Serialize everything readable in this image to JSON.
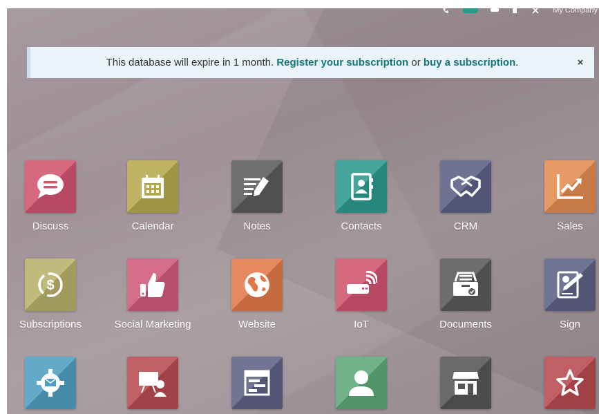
{
  "systray": {
    "company": "My Company"
  },
  "banner": {
    "text_before": "This database will expire in 1 month. ",
    "register_link": "Register your subscription",
    "text_middle": " or ",
    "buy_link": "buy a subscription",
    "text_after": ".",
    "close": "×"
  },
  "apps": [
    {
      "label": "Discuss",
      "icon": "chat-bubble-icon",
      "color": "#d0546f"
    },
    {
      "label": "Calendar",
      "icon": "calendar-icon",
      "color": "#b6a84e"
    },
    {
      "label": "Notes",
      "icon": "notes-icon",
      "color": "#5b5b5b"
    },
    {
      "label": "Contacts",
      "icon": "address-book-icon",
      "color": "#2e9a8e"
    },
    {
      "label": "CRM",
      "icon": "handshake-icon",
      "color": "#5c5f85"
    },
    {
      "label": "Sales",
      "icon": "trend-chart-icon",
      "color": "#e28b4f"
    },
    {
      "label": "Subscriptions",
      "icon": "dollar-cycle-icon",
      "color": "#b8b06a"
    },
    {
      "label": "Social Marketing",
      "icon": "thumbs-up-icon",
      "color": "#cf5a7b"
    },
    {
      "label": "Website",
      "icon": "globe-icon",
      "color": "#e0794a"
    },
    {
      "label": "IoT",
      "icon": "iot-device-icon",
      "color": "#d0546f"
    },
    {
      "label": "Documents",
      "icon": "file-drawer-icon",
      "color": "#595959"
    },
    {
      "label": "Sign",
      "icon": "sign-document-icon",
      "color": "#5f6184"
    },
    {
      "label": "",
      "icon": "gear-mail-icon",
      "color": "#4f9ec1"
    },
    {
      "label": "",
      "icon": "presentation-icon",
      "color": "#b84a4f"
    },
    {
      "label": "",
      "icon": "spreadsheet-icon",
      "color": "#5f6184"
    },
    {
      "label": "",
      "icon": "user-icon",
      "color": "#5da878"
    },
    {
      "label": "",
      "icon": "shop-icon",
      "color": "#555555"
    },
    {
      "label": "",
      "icon": "star-icon",
      "color": "#b84a4f"
    }
  ]
}
